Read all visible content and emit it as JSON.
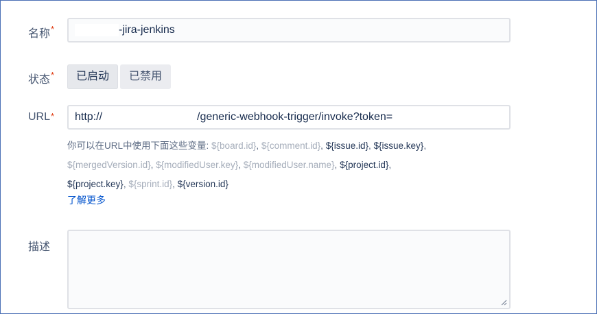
{
  "form": {
    "name": {
      "label": "名称",
      "required_mark": "*",
      "value_prefix": "",
      "value_suffix": "-jira-jenkins"
    },
    "status": {
      "label": "状态",
      "required_mark": "*",
      "options": [
        "已启动",
        "已禁用"
      ],
      "selected": "已启动"
    },
    "url": {
      "label": "URL",
      "required_mark": "*",
      "value_start": "http://",
      "value_middle": "/generic-webhook-trigger/invoke?token=",
      "value_end": ""
    },
    "help": {
      "intro": "你可以在URL中使用下面这些变量:",
      "variables": [
        {
          "text": "${board.id}",
          "sep": ", "
        },
        {
          "text": "${comment.id}",
          "sep": ", "
        },
        {
          "text": "${issue.id}",
          "sep": ", "
        },
        {
          "text": "${issue.key}",
          "sep": ","
        },
        {
          "text": "${mergedVersion.id}",
          "sep": ", "
        },
        {
          "text": "${modifiedUser.key}",
          "sep": ", "
        },
        {
          "text": "${modifiedUser.name}",
          "sep": ", "
        },
        {
          "text": "${project.id}",
          "sep": ","
        },
        {
          "text": "${project.key}",
          "sep": ", "
        },
        {
          "text": "${sprint.id}",
          "sep": ", "
        },
        {
          "text": "${version.id}",
          "sep": ""
        }
      ],
      "learn_more": "了解更多"
    },
    "description": {
      "label": "描述",
      "value": ""
    }
  },
  "colors": {
    "accent_link": "#0052cc",
    "required": "#de350b",
    "frame_border": "#4a6fb5"
  }
}
